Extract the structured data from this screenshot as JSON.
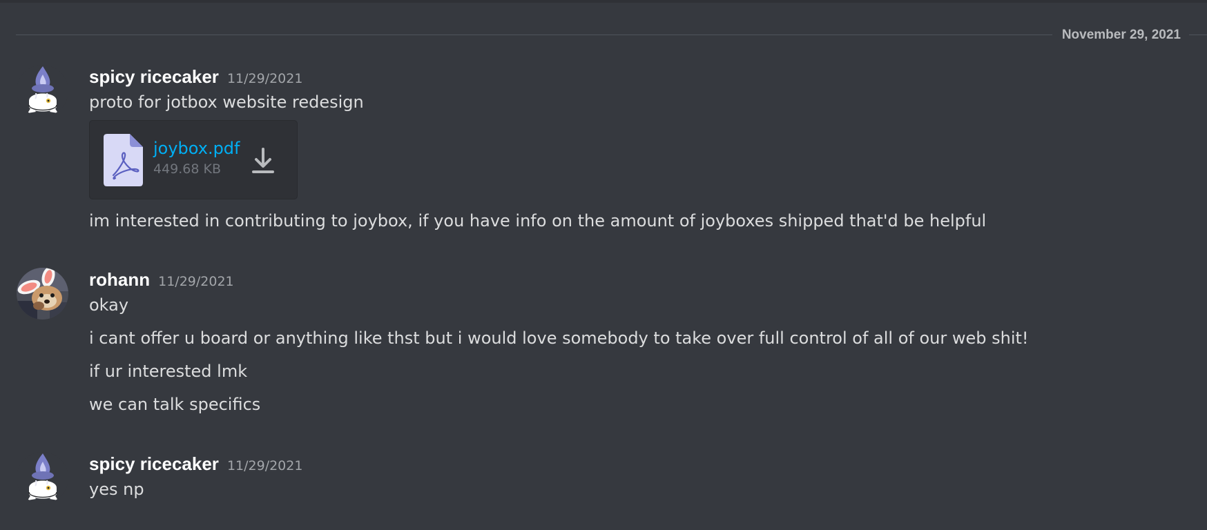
{
  "divider": {
    "date": "November 29, 2021"
  },
  "messages": [
    {
      "author": "spicy ricecaker",
      "timestamp": "11/29/2021",
      "avatar_icon": "litwick-candle-avatar",
      "lines": [
        "proto for jotbox website redesign"
      ],
      "attachment": {
        "filename": "joybox.pdf",
        "size": "449.68 KB",
        "file_icon": "pdf-file-icon",
        "download_icon": "download-icon"
      },
      "after_lines": [
        "im interested in contributing to joybox, if you have info on the amount of joyboxes shipped that'd be helpful"
      ]
    },
    {
      "author": "rohann",
      "timestamp": "11/29/2021",
      "avatar_icon": "bunny-ears-photo-avatar",
      "lines": [
        "okay",
        "i cant offer u board or anything like thst but i would love somebody to take over full control of all of our web shit!",
        "if ur interested lmk",
        "we can talk specifics"
      ]
    },
    {
      "author": "spicy ricecaker",
      "timestamp": "11/29/2021",
      "avatar_icon": "litwick-candle-avatar",
      "lines": [
        "yes np"
      ]
    }
  ],
  "colors": {
    "background": "#36393f",
    "link": "#00aff4",
    "username": "#ffffff",
    "text": "#dcddde",
    "muted": "#a3a6aa"
  }
}
